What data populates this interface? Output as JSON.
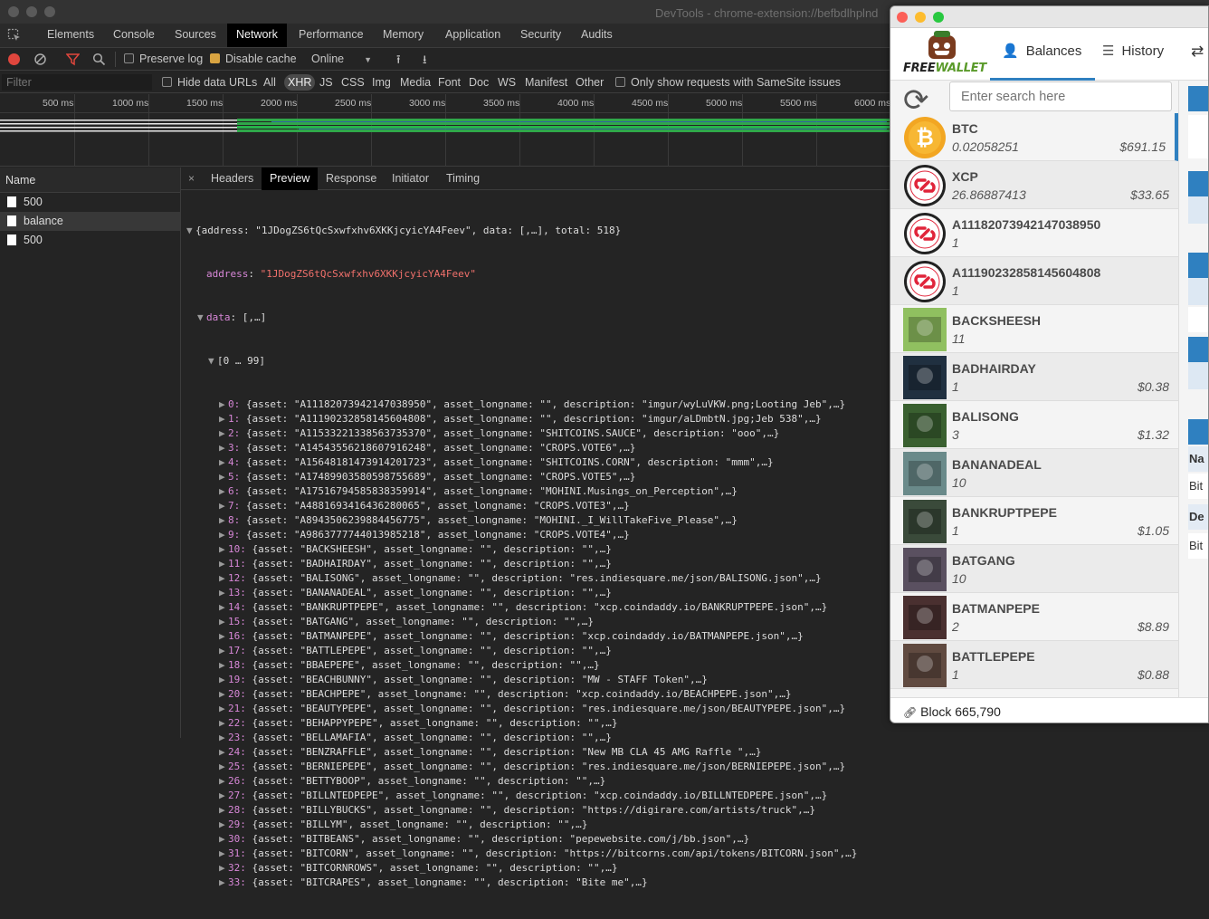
{
  "window_title": "DevTools - chrome-extension://befbdlhplnd",
  "devtools_tabs": [
    "Elements",
    "Console",
    "Sources",
    "Network",
    "Performance",
    "Memory",
    "Application",
    "Security",
    "Audits"
  ],
  "toolbar": {
    "preserve_log": "Preserve log",
    "disable_cache": "Disable cache",
    "throttle": "Online"
  },
  "filter": {
    "placeholder": "Filter",
    "hide_data_urls": "Hide data URLs",
    "types": [
      "All",
      "XHR",
      "JS",
      "CSS",
      "Img",
      "Media",
      "Font",
      "Doc",
      "WS",
      "Manifest",
      "Other"
    ],
    "samesite": "Only show requests with SameSite issues"
  },
  "timeline_ticks": [
    "500 ms",
    "1000 ms",
    "1500 ms",
    "2000 ms",
    "2500 ms",
    "3000 ms",
    "3500 ms",
    "4000 ms",
    "4500 ms",
    "5000 ms",
    "5500 ms",
    "6000 ms"
  ],
  "requests": {
    "header": "Name",
    "rows": [
      "500",
      "balance",
      "500"
    ]
  },
  "detail_tabs": [
    "Headers",
    "Preview",
    "Response",
    "Initiator",
    "Timing"
  ],
  "preview": {
    "root": "{address: \"1JDogZS6tQcSxwfxhv6XKKjcyicYA4Feev\", data: [,…], total: 518}",
    "address_key": "address",
    "address_val": "\"1JDogZS6tQcSxwfxhv6XKKjcyicYA4Feev\"",
    "data_key": "data",
    "data_val": "[,…]",
    "range": "[0 … 99]",
    "items": [
      "{asset: \"A11182073942147038950\", asset_longname: \"\", description: \"imgur/wyLuVKW.png;Looting Jeb\",…}",
      "{asset: \"A11190232858145604808\", asset_longname: \"\", description: \"imgur/aLDmbtN.jpg;Jeb 538\",…}",
      "{asset: \"A11533221338563735370\", asset_longname: \"SHITCOINS.SAUCE\", description: \"ooo\",…}",
      "{asset: \"A14543556218607916248\", asset_longname: \"CROPS.VOTE6\",…}",
      "{asset: \"A15648181473914201723\", asset_longname: \"SHITCOINS.CORN\", description: \"mmm\",…}",
      "{asset: \"A17489903580598755689\", asset_longname: \"CROPS.VOTE5\",…}",
      "{asset: \"A17516794585838359914\", asset_longname: \"MOHINI.Musings_on_Perception\",…}",
      "{asset: \"A4881693416436280065\", asset_longname: \"CROPS.VOTE3\",…}",
      "{asset: \"A8943506239884456775\", asset_longname: \"MOHINI._I_WillTakeFive_Please\",…}",
      "{asset: \"A9863777744013985218\", asset_longname: \"CROPS.VOTE4\",…}",
      "{asset: \"BACKSHEESH\", asset_longname: \"\", description: \"\",…}",
      "{asset: \"BADHAIRDAY\", asset_longname: \"\", description: \"\",…}",
      "{asset: \"BALISONG\", asset_longname: \"\", description: \"res.indiesquare.me/json/BALISONG.json\",…}",
      "{asset: \"BANANADEAL\", asset_longname: \"\", description: \"\",…}",
      "{asset: \"BANKRUPTPEPE\", asset_longname: \"\", description: \"xcp.coindaddy.io/BANKRUPTPEPE.json\",…}",
      "{asset: \"BATGANG\", asset_longname: \"\", description: \"\",…}",
      "{asset: \"BATMANPEPE\", asset_longname: \"\", description: \"xcp.coindaddy.io/BATMANPEPE.json\",…}",
      "{asset: \"BATTLEPEPE\", asset_longname: \"\", description: \"\",…}",
      "{asset: \"BBAEPEPE\", asset_longname: \"\", description: \"\",…}",
      "{asset: \"BEACHBUNNY\", asset_longname: \"\", description: \"MW - STAFF Token\",…}",
      "{asset: \"BEACHPEPE\", asset_longname: \"\", description: \"xcp.coindaddy.io/BEACHPEPE.json\",…}",
      "{asset: \"BEAUTYPEPE\", asset_longname: \"\", description: \"res.indiesquare.me/json/BEAUTYPEPE.json\",…}",
      "{asset: \"BEHAPPYPEPE\", asset_longname: \"\", description: \"\",…}",
      "{asset: \"BELLAMAFIA\", asset_longname: \"\", description: \"\",…}",
      "{asset: \"BENZRAFFLE\", asset_longname: \"\", description: \"New MB CLA 45 AMG Raffle \",…}",
      "{asset: \"BERNIEPEPE\", asset_longname: \"\", description: \"res.indiesquare.me/json/BERNIEPEPE.json\",…}",
      "{asset: \"BETTYBOOP\", asset_longname: \"\", description: \"\",…}",
      "{asset: \"BILLNTEDPEPE\", asset_longname: \"\", description: \"xcp.coindaddy.io/BILLNTEDPEPE.json\",…}",
      "{asset: \"BILLYBUCKS\", asset_longname: \"\", description: \"https://digirare.com/artists/truck\",…}",
      "{asset: \"BILLYM\", asset_longname: \"\", description: \"\",…}",
      "{asset: \"BITBEANS\", asset_longname: \"\", description: \"pepewebsite.com/j/bb.json\",…}",
      "{asset: \"BITCORN\", asset_longname: \"\", description: \"https://bitcorns.com/api/tokens/BITCORN.json\",…}",
      "{asset: \"BITCORNROWS\", asset_longname: \"\", description: \"\",…}",
      "{asset: \"BITCRAPES\", asset_longname: \"\", description: \"Bite me\",…}"
    ]
  },
  "wallet": {
    "brand_a": "FREE",
    "brand_b": "WALLET",
    "tabs": [
      "Balances",
      "History"
    ],
    "search_placeholder": "Enter search here",
    "footer": "Block 665,790",
    "items": [
      {
        "name": "BTC",
        "amount": "0.02058251",
        "value": "$691.15",
        "icon": "bitcoin-icon"
      },
      {
        "name": "XCP",
        "amount": "26.86887413",
        "value": "$33.65",
        "icon": "counterparty-icon"
      },
      {
        "name": "A11182073942147038950",
        "amount": "1",
        "value": "",
        "icon": "counterparty-icon"
      },
      {
        "name": "A11190232858145604808",
        "amount": "1",
        "value": "",
        "icon": "counterparty-icon"
      },
      {
        "name": "BACKSHEESH",
        "amount": "11",
        "value": "",
        "icon": "asset-image"
      },
      {
        "name": "BADHAIRDAY",
        "amount": "1",
        "value": "$0.38",
        "icon": "asset-image"
      },
      {
        "name": "BALISONG",
        "amount": "3",
        "value": "$1.32",
        "icon": "asset-image"
      },
      {
        "name": "BANANADEAL",
        "amount": "10",
        "value": "",
        "icon": "asset-image"
      },
      {
        "name": "BANKRUPTPEPE",
        "amount": "1",
        "value": "$1.05",
        "icon": "asset-image"
      },
      {
        "name": "BATGANG",
        "amount": "10",
        "value": "",
        "icon": "asset-image"
      },
      {
        "name": "BATMANPEPE",
        "amount": "2",
        "value": "$8.89",
        "icon": "asset-image"
      },
      {
        "name": "BATTLEPEPE",
        "amount": "1",
        "value": "$0.88",
        "icon": "asset-image"
      }
    ],
    "right_labels": [
      "Na",
      "Bit",
      "De",
      "Bit"
    ]
  }
}
